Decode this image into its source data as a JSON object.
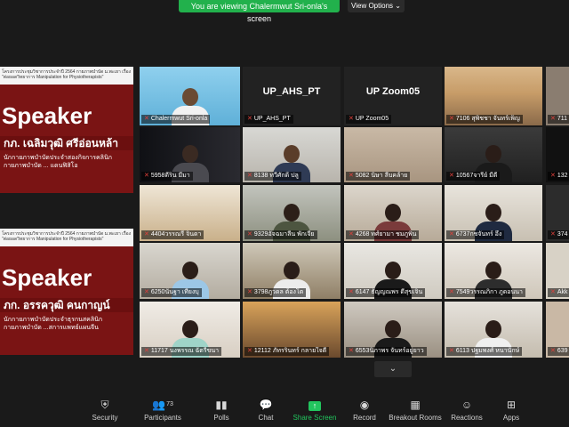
{
  "banner": "You are viewing Chalermwut Sri-onla's screen",
  "view_options": "View Options ⌄",
  "slides": [
    {
      "header": "โครงการประชุมวิชาการประจำปี 2564 กายภาพบำบัด ม.พะเยา เรื่อง \"ต่อยอดวิทยาการ Manipulation for Physiotherapists\"",
      "speaker": "Speaker",
      "name": "กภ. เฉลิมวุฒิ ศรีอ่อนหล้า",
      "desc": "นักกายภาพบำบัดประจำสองกิจการคลินิกกายภาพบำบัด ... แดนฟิสิโอ"
    },
    {
      "header": "โครงการประชุมวิชาการประจำปี 2564 กายภาพบำบัด ม.พะเยา เรื่อง \"ต่อยอดวิทยาการ Manipulation for Physiotherapists\"",
      "speaker": "Speaker",
      "name": "ภก. อรรควุฒิ คนกาญน์",
      "desc": "นักกายภาพบำบัดประจำธุรกนสคลินิกกายภาพบำบัด ...สการแพทย์แผนจีน"
    }
  ],
  "tiles": [
    {
      "label": "Chalermwut Sri-onla",
      "big": ""
    },
    {
      "label": "UP_AHS_PT",
      "big": "UP_AHS_PT"
    },
    {
      "label": "UP Zoom05",
      "big": "UP Zoom05"
    },
    {
      "label": "7106 สุพิชชา จันทร์เพ็ญ",
      "big": ""
    },
    {
      "label": "711",
      "big": ""
    },
    {
      "label": "5958ดีริน มีมา",
      "big": ""
    },
    {
      "label": "8138 ทวีศักดิ์ ปลู",
      "big": ""
    },
    {
      "label": "5082 นิษา ลีบคล้าย",
      "big": ""
    },
    {
      "label": "10567จารีย์ มีดี",
      "big": ""
    },
    {
      "label": "132",
      "big": ""
    },
    {
      "label": "4404วรรณรี จินดา",
      "big": ""
    },
    {
      "label": "9329อัจฉมาลีน พักเจีย",
      "big": ""
    },
    {
      "label": "4268 ทศ์ยามา ชมภูพิน",
      "big": ""
    },
    {
      "label": "6737กชจันทร์ อึ้ง",
      "big": ""
    },
    {
      "label": "374",
      "big": ""
    },
    {
      "label": "6250นันฐา เที่ยงบุ",
      "big": ""
    },
    {
      "label": "3798ภูวดล ต้องโต",
      "big": ""
    },
    {
      "label": "6147 ธัญญณพร ดีสุขเจิน",
      "big": ""
    },
    {
      "label": "7549วรรณภิกา ภูดอนนา",
      "big": ""
    },
    {
      "label": "Akk",
      "big": ""
    },
    {
      "label": "11717 นงพรรณ ฉัตรีขนา",
      "big": ""
    },
    {
      "label": "12112 ภัทรรินทร์ กลายใจดี",
      "big": ""
    },
    {
      "label": "6553นิภาพร จันทร์อยู่ยาว",
      "big": ""
    },
    {
      "label": "6113 ปฐมพงศ์ หนานักษ์",
      "big": ""
    },
    {
      "label": "639",
      "big": ""
    }
  ],
  "toolbar": {
    "security": "Security",
    "participants": "Participants",
    "participants_count": "73",
    "polls": "Polls",
    "chat": "Chat",
    "share": "Share Screen",
    "record": "Record",
    "breakout": "Breakout Rooms",
    "reactions": "Reactions",
    "apps": "Apps"
  },
  "colors": {
    "accent_green": "#22b14c",
    "active_border": "#e9e36a",
    "mute_red": "#e0403b"
  }
}
